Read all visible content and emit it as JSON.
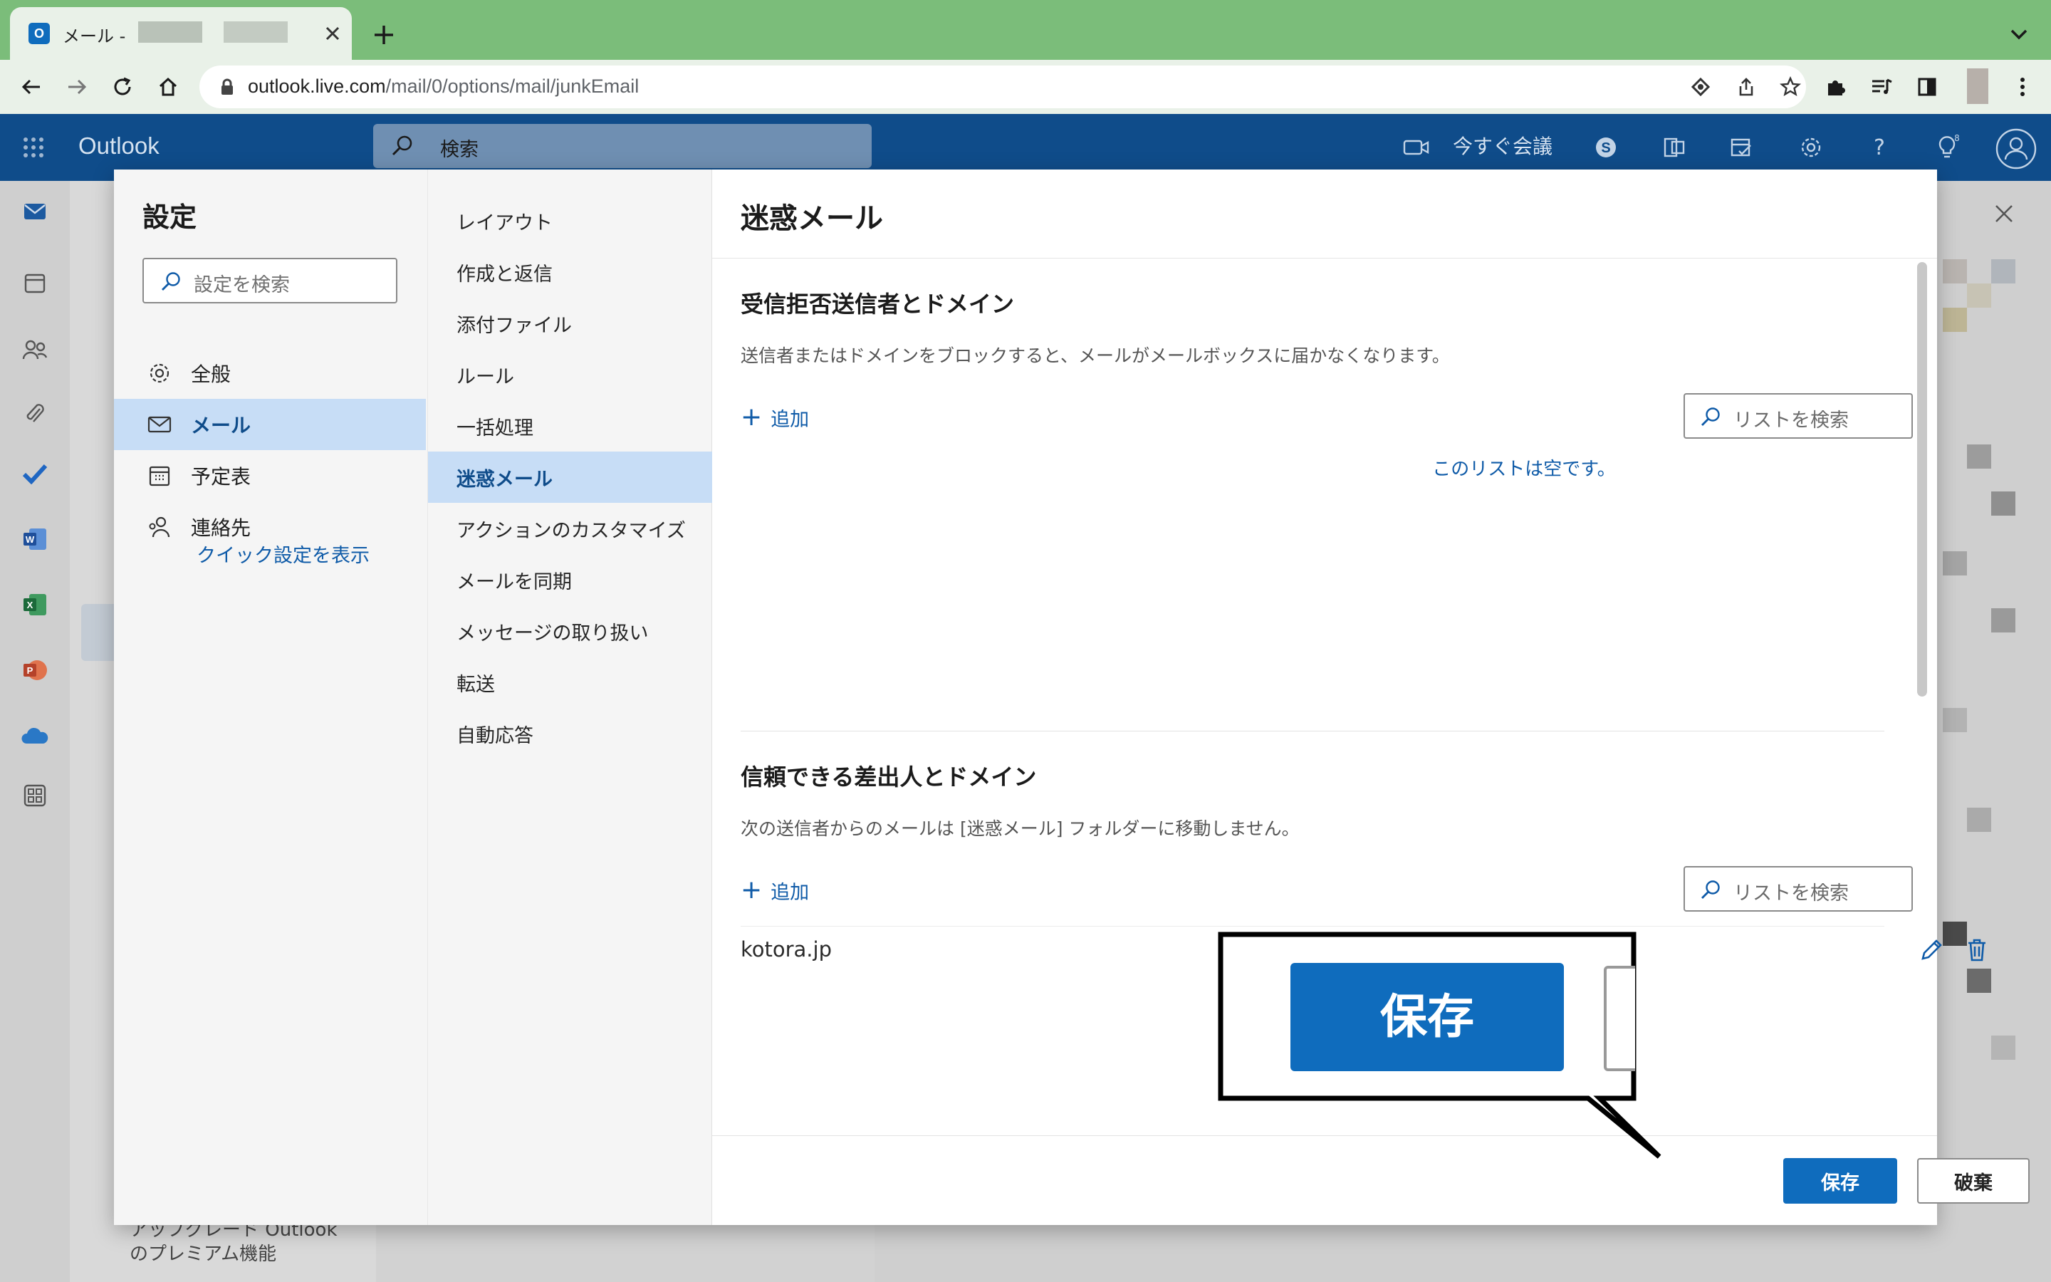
{
  "browser": {
    "tab_title": "メール -",
    "favicon_letter": "O",
    "url_host": "outlook.live.com",
    "url_path": "/mail/0/options/mail/junkEmail"
  },
  "outlook": {
    "brand": "Outlook",
    "search_placeholder": "検索",
    "meet_now": "今すぐ会議",
    "notification_count": "8"
  },
  "background": {
    "premium_line1": "アップグレード Outlook",
    "premium_line2": "のプレミアム機能"
  },
  "settings": {
    "title": "設定",
    "search_placeholder": "設定を検索",
    "categories": [
      {
        "label": "全般",
        "icon": "gear-icon",
        "active": false
      },
      {
        "label": "メール",
        "icon": "mail-icon",
        "active": true
      },
      {
        "label": "予定表",
        "icon": "calendar-icon",
        "active": false
      },
      {
        "label": "連絡先",
        "icon": "people-icon",
        "active": false
      }
    ],
    "quick_settings": "クイック設定を表示",
    "mail_sections": [
      {
        "label": "レイアウト",
        "active": false
      },
      {
        "label": "作成と返信",
        "active": false
      },
      {
        "label": "添付ファイル",
        "active": false
      },
      {
        "label": "ルール",
        "active": false
      },
      {
        "label": "一括処理",
        "active": false
      },
      {
        "label": "迷惑メール",
        "active": true
      },
      {
        "label": "アクションのカスタマイズ",
        "active": false
      },
      {
        "label": "メールを同期",
        "active": false
      },
      {
        "label": "メッセージの取り扱い",
        "active": false
      },
      {
        "label": "転送",
        "active": false
      },
      {
        "label": "自動応答",
        "active": false
      }
    ]
  },
  "junk": {
    "title": "迷惑メール",
    "blocked": {
      "title": "受信拒否送信者とドメイン",
      "description": "送信者またはドメインをブロックすると、メールがメールボックスに届かなくなります。",
      "add_label": "追加",
      "search_placeholder": "リストを検索",
      "empty_message": "このリストは空です。"
    },
    "safe": {
      "title": "信頼できる差出人とドメイン",
      "description": "次の送信者からのメールは [迷惑メール] フォルダーに移動しません。",
      "add_label": "追加",
      "search_placeholder": "リストを検索",
      "entries": [
        "kotora.jp"
      ]
    },
    "save_label": "保存",
    "discard_label": "破棄"
  },
  "callout": {
    "label": "保存"
  },
  "colors": {
    "browser_frame": "#7bbd7a",
    "outlook_bar": "#0f4c8a",
    "accent": "#0f6cbd",
    "selection": "#c7ddf6"
  }
}
